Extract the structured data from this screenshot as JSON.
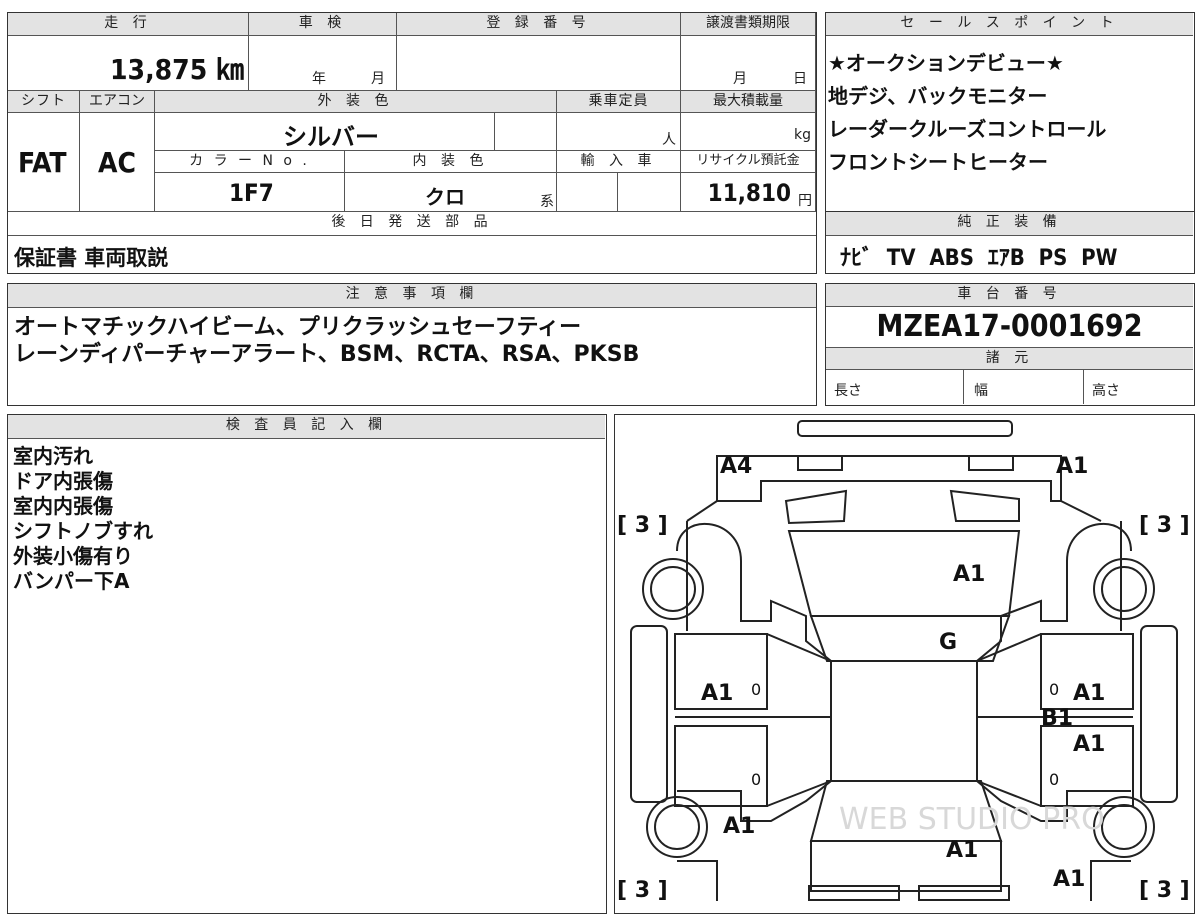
{
  "top_table": {
    "h_mileage": "走 行",
    "h_inspection": "車 検",
    "h_registration": "登 録 番 号",
    "h_transfer_deadline": "譲渡書類期限",
    "mileage": "13,875 ㎞",
    "inspection_year_unit": "年",
    "inspection_month_unit": "月",
    "transfer_month_unit": "月",
    "transfer_day_unit": "日",
    "h_shift": "シフト",
    "h_aircon": "エアコン",
    "h_exterior_color": "外 装 色",
    "h_capacity": "乗車定員",
    "h_max_load": "最大積載量",
    "shift": "FAT",
    "aircon": "AC",
    "exterior_color": "シルバー",
    "capacity_unit": "人",
    "max_load_unit": "kg",
    "h_color_no": "カ ラ ー N o .",
    "h_interior_color": "内 装 色",
    "h_import": "輸 入 車",
    "h_recycle": "リサイクル預託金",
    "color_no": "1F7",
    "interior_color": "クロ",
    "interior_suffix": "系",
    "recycle_fee": "11,810",
    "recycle_unit": "円",
    "h_later_parts": "後 日 発 送 部 品",
    "later_parts": "保証書 車両取説"
  },
  "sales_points": {
    "header": "セ ー ル ス ポ イ ン ト",
    "lines": [
      "★オークションデビュー★",
      "地デジ、バックモニター",
      "レーダークルーズコントロール",
      "フロントシートヒーター"
    ]
  },
  "equipment": {
    "header": "純 正 装 備",
    "value": "ﾅﾋﾞ  TV  ABS  ｴｱB  PS  PW"
  },
  "notes": {
    "header": "注 意 事 項 欄",
    "lines": [
      "オートマチックハイビーム、プリクラッシュセーフティー",
      "レーンディパーチャーアラート、BSM、RCTA、RSA、PKSB"
    ]
  },
  "chassis": {
    "header": "車 台 番 号",
    "value": "MZEA17-0001692",
    "spec_header": "諸 元",
    "length_label": "長さ",
    "width_label": "幅",
    "height_label": "高さ"
  },
  "inspector": {
    "header": "検 査 員 記 入 欄",
    "lines": [
      "室内汚れ",
      "ドア内張傷",
      "室内内張傷",
      "シフトノブすれ",
      "外装小傷有り",
      "バンパー下A"
    ]
  },
  "diagram": {
    "tire_labels": [
      "[ 3 ]",
      "[ 3 ]",
      "[ 3 ]",
      "[ 3 ]"
    ],
    "marks": [
      "A4",
      "A1",
      "A1",
      "G",
      "A1",
      "A1",
      "B1",
      "A1",
      "A1",
      "A1",
      "A1"
    ],
    "door_zeros": [
      "0",
      "0",
      "0",
      "0"
    ],
    "watermark": "WEB STUDIO PRO"
  }
}
